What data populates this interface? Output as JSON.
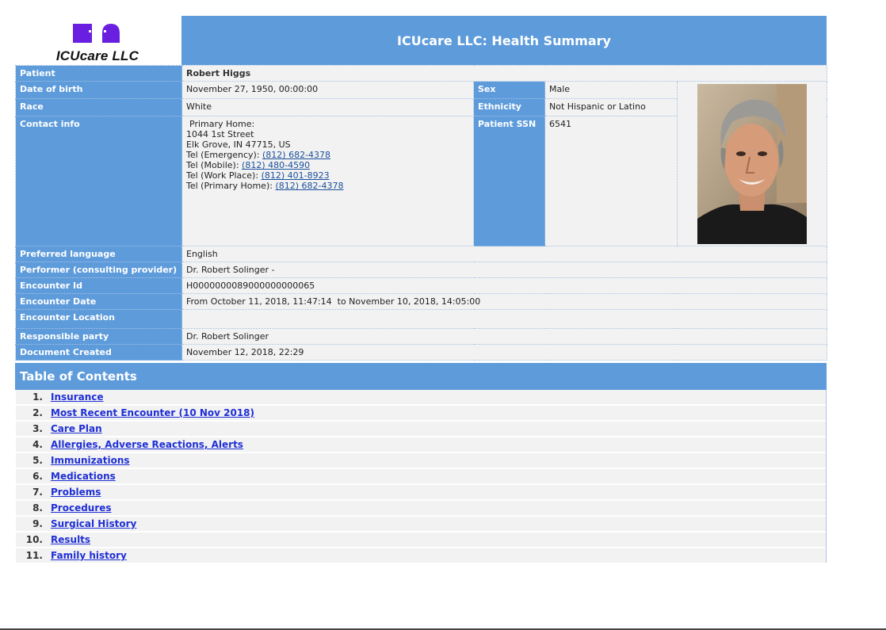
{
  "header": {
    "logo_text": "ICUcare LLC",
    "title": "ICUcare LLC: Health Summary"
  },
  "patient": {
    "section_label": "Patient",
    "name": "Robert Higgs",
    "dob_label": "Date of birth",
    "dob": "November 27, 1950, 00:00:00",
    "sex_label": "Sex",
    "sex": "Male",
    "race_label": "Race",
    "race": "White",
    "ethnicity_label": "Ethnicity",
    "ethnicity": "Not Hispanic or Latino",
    "contact_label": "Contact info",
    "contact": {
      "type": "Primary Home:",
      "street": "1044 1st Street",
      "city": "Elk Grove, IN 47715, US",
      "phones": [
        {
          "label": "Tel (Emergency): ",
          "number": "(812) 682-4378"
        },
        {
          "label": "Tel (Mobile): ",
          "number": "(812) 480-4590"
        },
        {
          "label": "Tel (Work Place): ",
          "number": "(812) 401-8923"
        },
        {
          "label": "Tel (Primary Home): ",
          "number": "(812) 682-4378"
        }
      ]
    },
    "ssn_label": "Patient SSN",
    "ssn": "6541",
    "language_label": "Preferred language",
    "language": "English",
    "performer_label": "Performer (consulting provider)",
    "performer": "Dr. Robert Solinger -",
    "encounter_id_label": "Encounter Id",
    "encounter_id": "H0000000089000000000065",
    "encounter_date_label": "Encounter Date",
    "encounter_date": "From October 11, 2018, 11:47:14  to November 10, 2018, 14:05:00",
    "encounter_location_label": "Encounter Location",
    "encounter_location": "",
    "responsible_label": "Responsible party",
    "responsible": "Dr. Robert Solinger",
    "created_label": "Document Created",
    "created": "November 12, 2018, 22:29"
  },
  "toc": {
    "title": "Table of Contents",
    "items": [
      {
        "num": "1.",
        "label": "Insurance"
      },
      {
        "num": "2.",
        "label": "Most Recent Encounter (10 Nov 2018)"
      },
      {
        "num": "3.",
        "label": "Care Plan"
      },
      {
        "num": "4.",
        "label": "Allergies, Adverse Reactions, Alerts"
      },
      {
        "num": "5.",
        "label": "Immunizations"
      },
      {
        "num": "6.",
        "label": "Medications"
      },
      {
        "num": "7.",
        "label": "Problems"
      },
      {
        "num": "8.",
        "label": "Procedures"
      },
      {
        "num": "9.",
        "label": "Surgical History"
      },
      {
        "num": "10.",
        "label": "Results"
      },
      {
        "num": "11.",
        "label": "Family history"
      }
    ]
  },
  "colors": {
    "header_blue": "#5d9bdb",
    "row_gray": "#f2f2f2",
    "link_blue": "#1f2fd6",
    "logo_purple": "#6a1fe0"
  }
}
